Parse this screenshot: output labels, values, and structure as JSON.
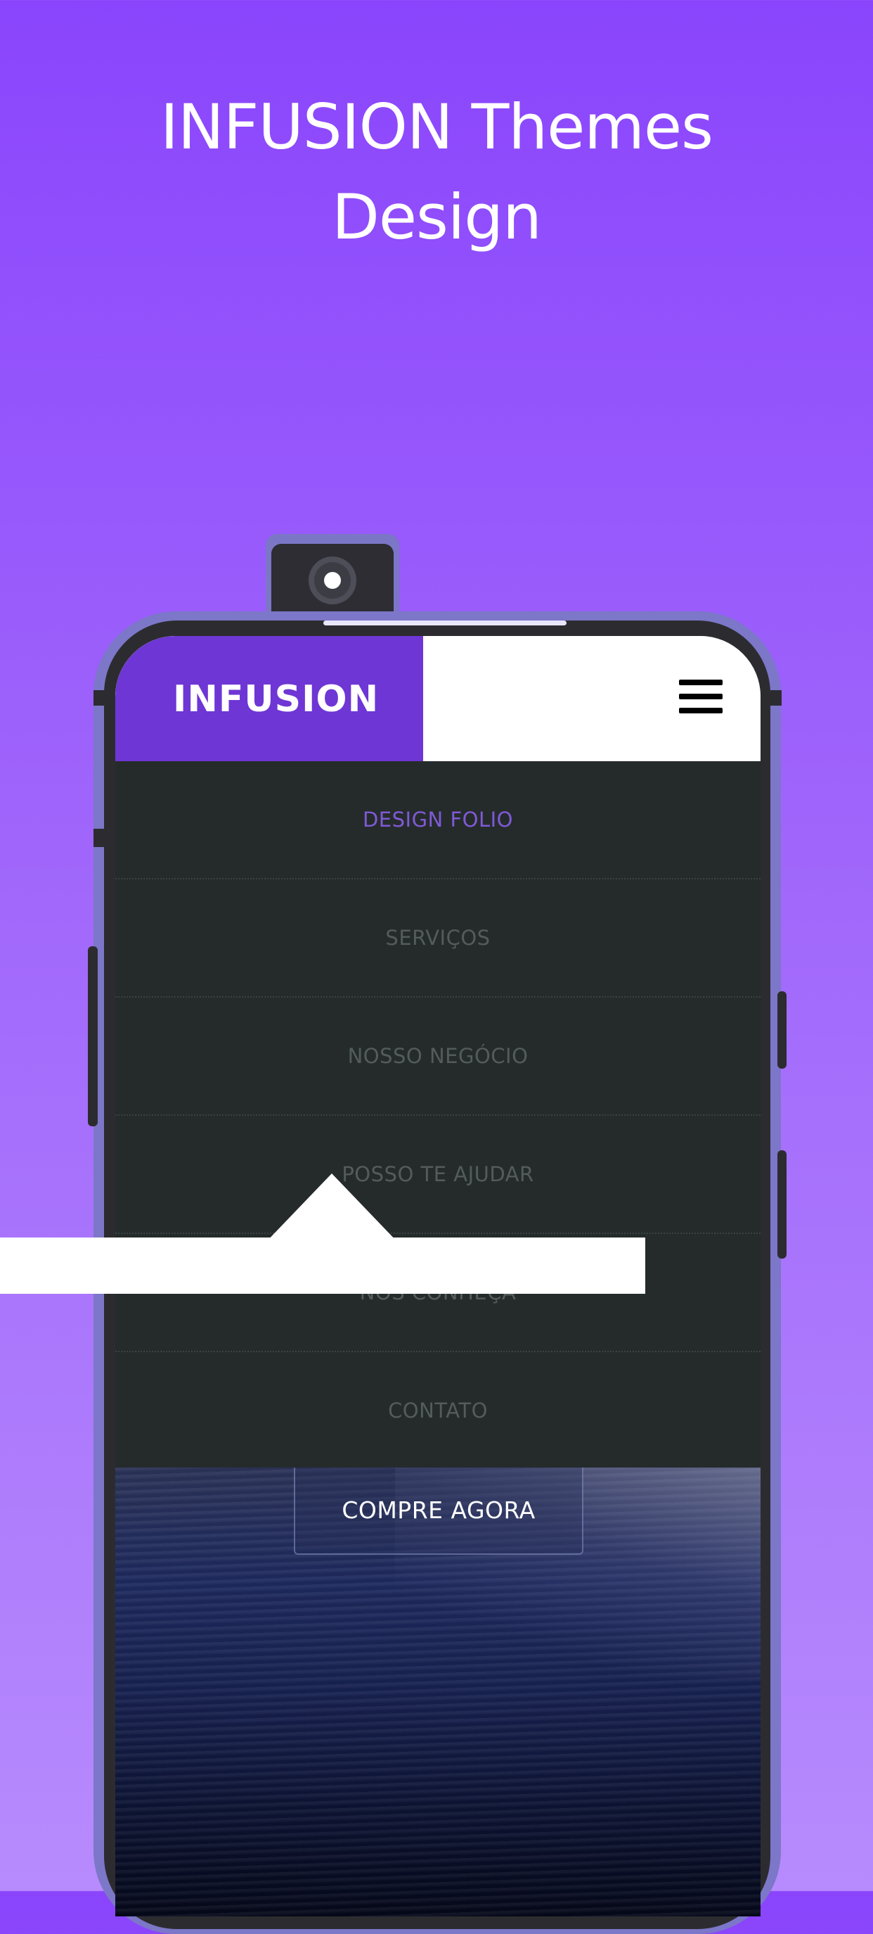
{
  "promo": {
    "title_line1": "INFUSION Themes",
    "title_line2": "Design"
  },
  "app": {
    "brand": "INFUSION",
    "brand_color": "#6e36d4",
    "menu_icon": "hamburger-menu-icon"
  },
  "nav": {
    "items": [
      {
        "label": "DESIGN FOLIO",
        "active": true
      },
      {
        "label": "SERVIÇOS",
        "active": false
      },
      {
        "label": "NOSSO NEGÓCIO",
        "active": false
      },
      {
        "label": "POSSO TE AJUDAR",
        "active": false
      },
      {
        "label": "NOS CONHEÇA",
        "active": false
      },
      {
        "label": "CONTATO",
        "active": false
      }
    ],
    "background": "#252b2b",
    "active_color": "#7f5ad6"
  },
  "hero": {
    "cta_label": "COMPRE AGORA",
    "scroll_icon": "scroll-down-arrow-icon"
  },
  "colors": {
    "background_top": "#8a45fc",
    "background_bottom": "#b78bfd",
    "phone_body": "#7c77c8"
  }
}
